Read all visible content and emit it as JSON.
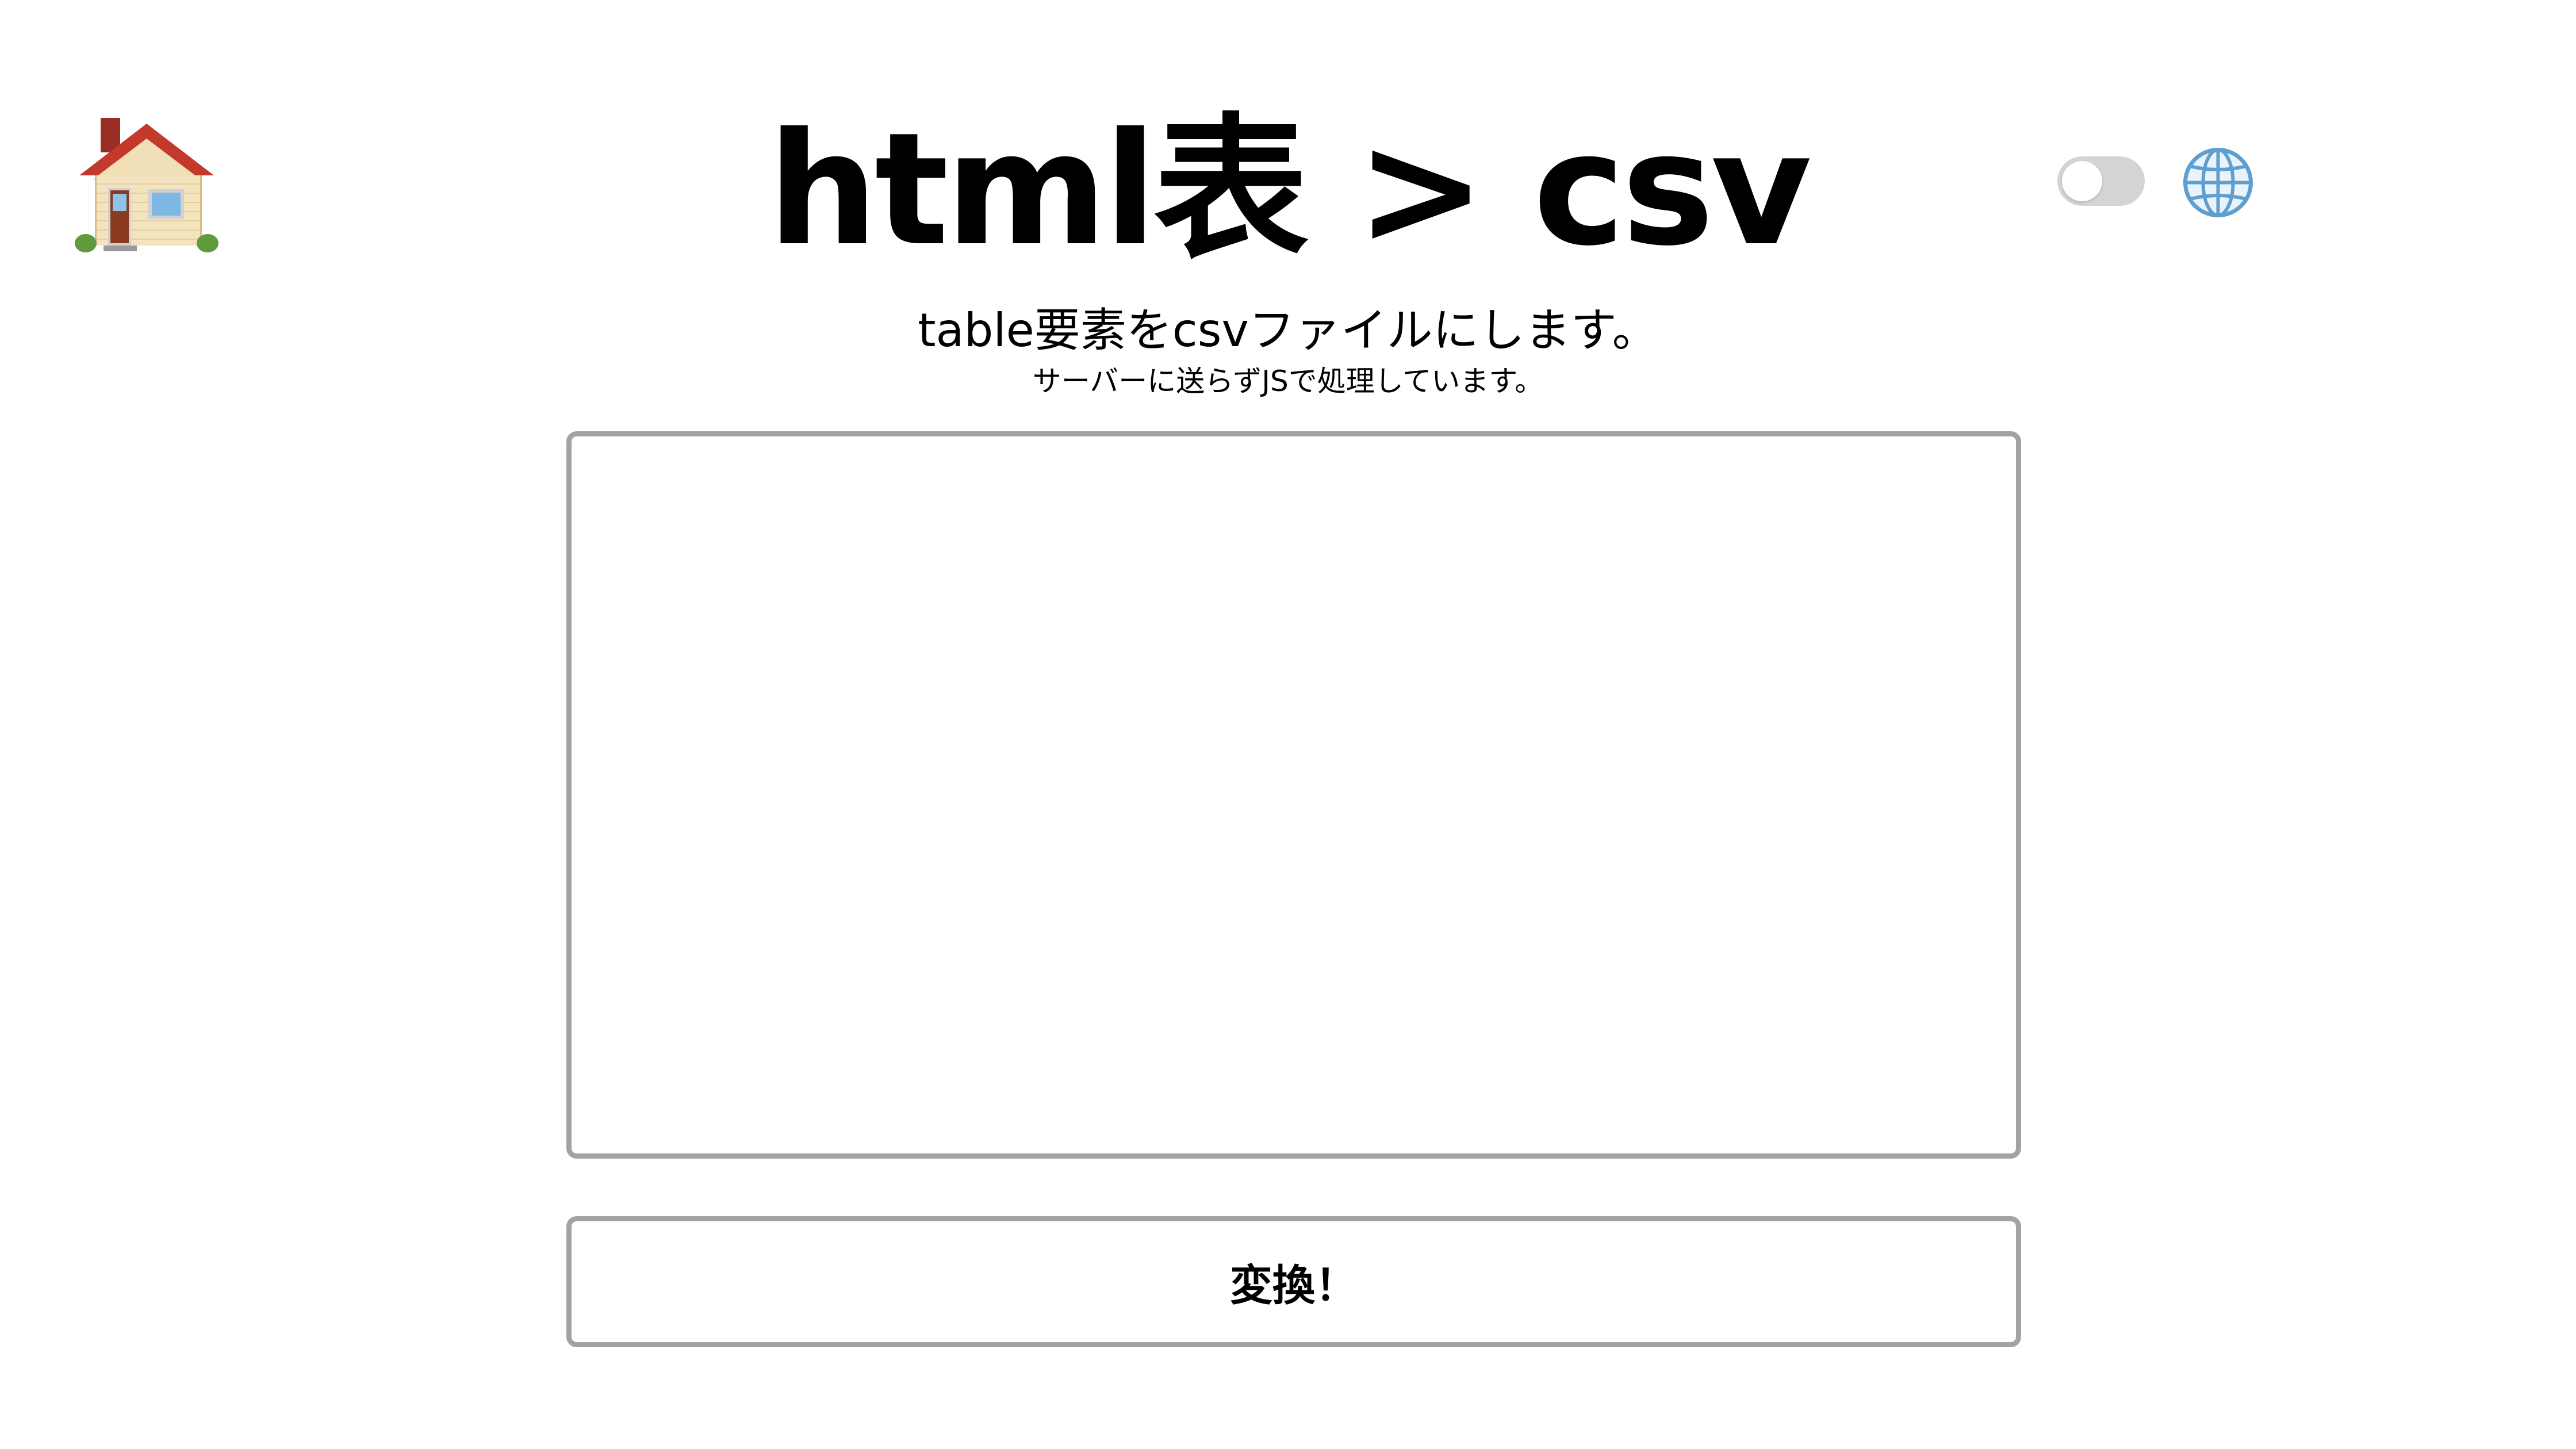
{
  "header": {
    "home_icon": "house-icon",
    "title": "html表 > csv",
    "subtitle": "table要素をcsvファイルにします。",
    "note": "サーバーに送らずJSで処理しています。"
  },
  "controls": {
    "theme_toggle": {
      "icon": "toggle-switch",
      "on": false
    },
    "language_icon": "globe-icon"
  },
  "editor": {
    "value": "",
    "placeholder": ""
  },
  "actions": {
    "convert_label": "変換！"
  },
  "colors": {
    "background": "#ffffff",
    "border": "#a3a3a3",
    "toggle_track": "#d4d4d4",
    "text": "#000000"
  }
}
